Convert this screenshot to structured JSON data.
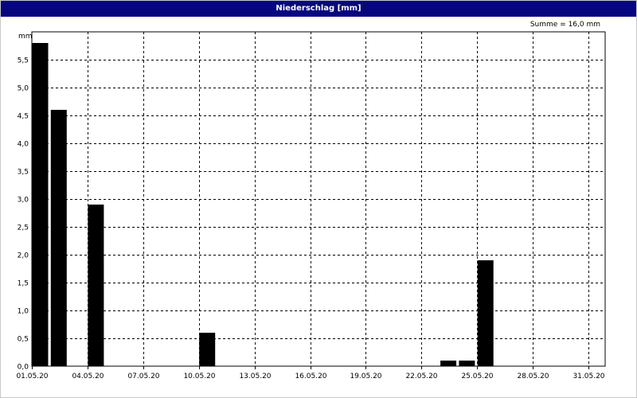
{
  "window": {
    "title": "Niederschlag [mm]"
  },
  "annotation": {
    "sum": "Summe = 16,0 mm"
  },
  "colors": {
    "title_bar": "#06067f",
    "bars": "#000000",
    "grid": "#000000",
    "background": "#ffffff"
  },
  "chart_data": {
    "type": "bar",
    "title": "Niederschlag [mm]",
    "ylabel": "mm",
    "xlabel": "",
    "ylim": [
      0,
      6
    ],
    "yticks": [
      "0,0",
      "0,5",
      "1,0",
      "1,5",
      "2,0",
      "2,5",
      "3,0",
      "3,5",
      "4,0",
      "4,5",
      "5,0",
      "5,5"
    ],
    "xticks": [
      "01.05.20",
      "04.05.20",
      "07.05.20",
      "10.05.20",
      "13.05.20",
      "16.05.20",
      "19.05.20",
      "22.05.20",
      "25.05.20",
      "28.05.20",
      "31.05.20"
    ],
    "grid": true,
    "grid_style": "dashed",
    "x": [
      "01.05.20",
      "02.05.20",
      "04.05.20",
      "10.05.20",
      "23.05.20",
      "24.05.20",
      "25.05.20"
    ],
    "values": [
      5.8,
      4.6,
      2.9,
      0.6,
      0.1,
      0.1,
      1.9
    ]
  }
}
